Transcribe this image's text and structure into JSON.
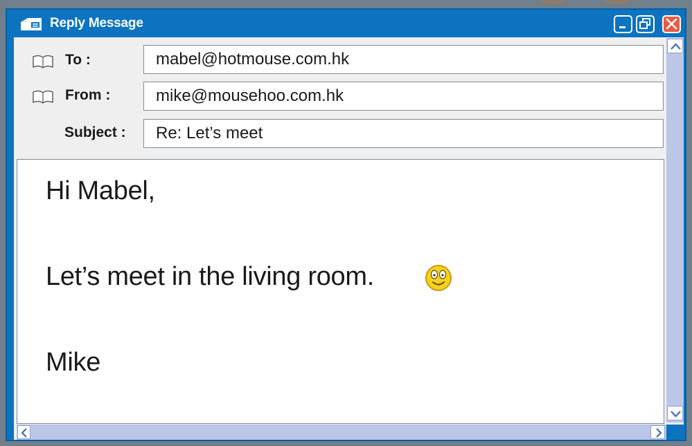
{
  "window": {
    "title": "Reply Message"
  },
  "header": {
    "to_label": "To :",
    "to_value": "mabel@hotmouse.com.hk",
    "from_label": "From :",
    "from_value": "mike@mousehoo.com.hk",
    "subject_label": "Subject :",
    "subject_value": "Re: Let’s meet"
  },
  "message": {
    "greeting": "Hi Mabel,",
    "line": "Let’s meet in the living room.",
    "signature": "Mike"
  },
  "icons": {
    "title": "envelope-icon",
    "address_book": "address-book-icon",
    "emoticon": "smiley-face-icon",
    "minimize": "minimize-icon",
    "restore": "restore-icon",
    "close": "close-icon"
  },
  "colors": {
    "title_bar": "#0c73c0",
    "close_button": "#e85a43",
    "scrollbar": "#bcc6e6"
  }
}
